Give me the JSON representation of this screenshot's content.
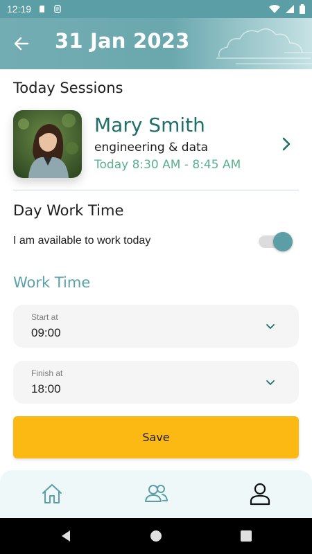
{
  "status_bar": {
    "time": "12:19"
  },
  "header": {
    "title": "31 Jan 2023"
  },
  "sessions": {
    "title": "Today Sessions",
    "card": {
      "name": "Mary Smith",
      "role": "engineering & data",
      "time": "Today 8:30 AM - 8:45 AM"
    }
  },
  "day_work": {
    "title": "Day Work Time",
    "available_label": "I am available to work today",
    "available": true
  },
  "work_time": {
    "title": "Work Time",
    "start": {
      "label": "Start at",
      "value": "09:00"
    },
    "finish": {
      "label": "Finish at",
      "value": "18:00"
    }
  },
  "actions": {
    "save_label": "Save"
  },
  "bottom_nav": {
    "items": [
      "home-icon",
      "people-icon",
      "profile-icon"
    ],
    "active": "profile-icon"
  },
  "colors": {
    "primary": "#5b9ea6",
    "accent_green": "#59b08f",
    "name_teal": "#1f6f69",
    "save_yellow": "#fdb913"
  }
}
